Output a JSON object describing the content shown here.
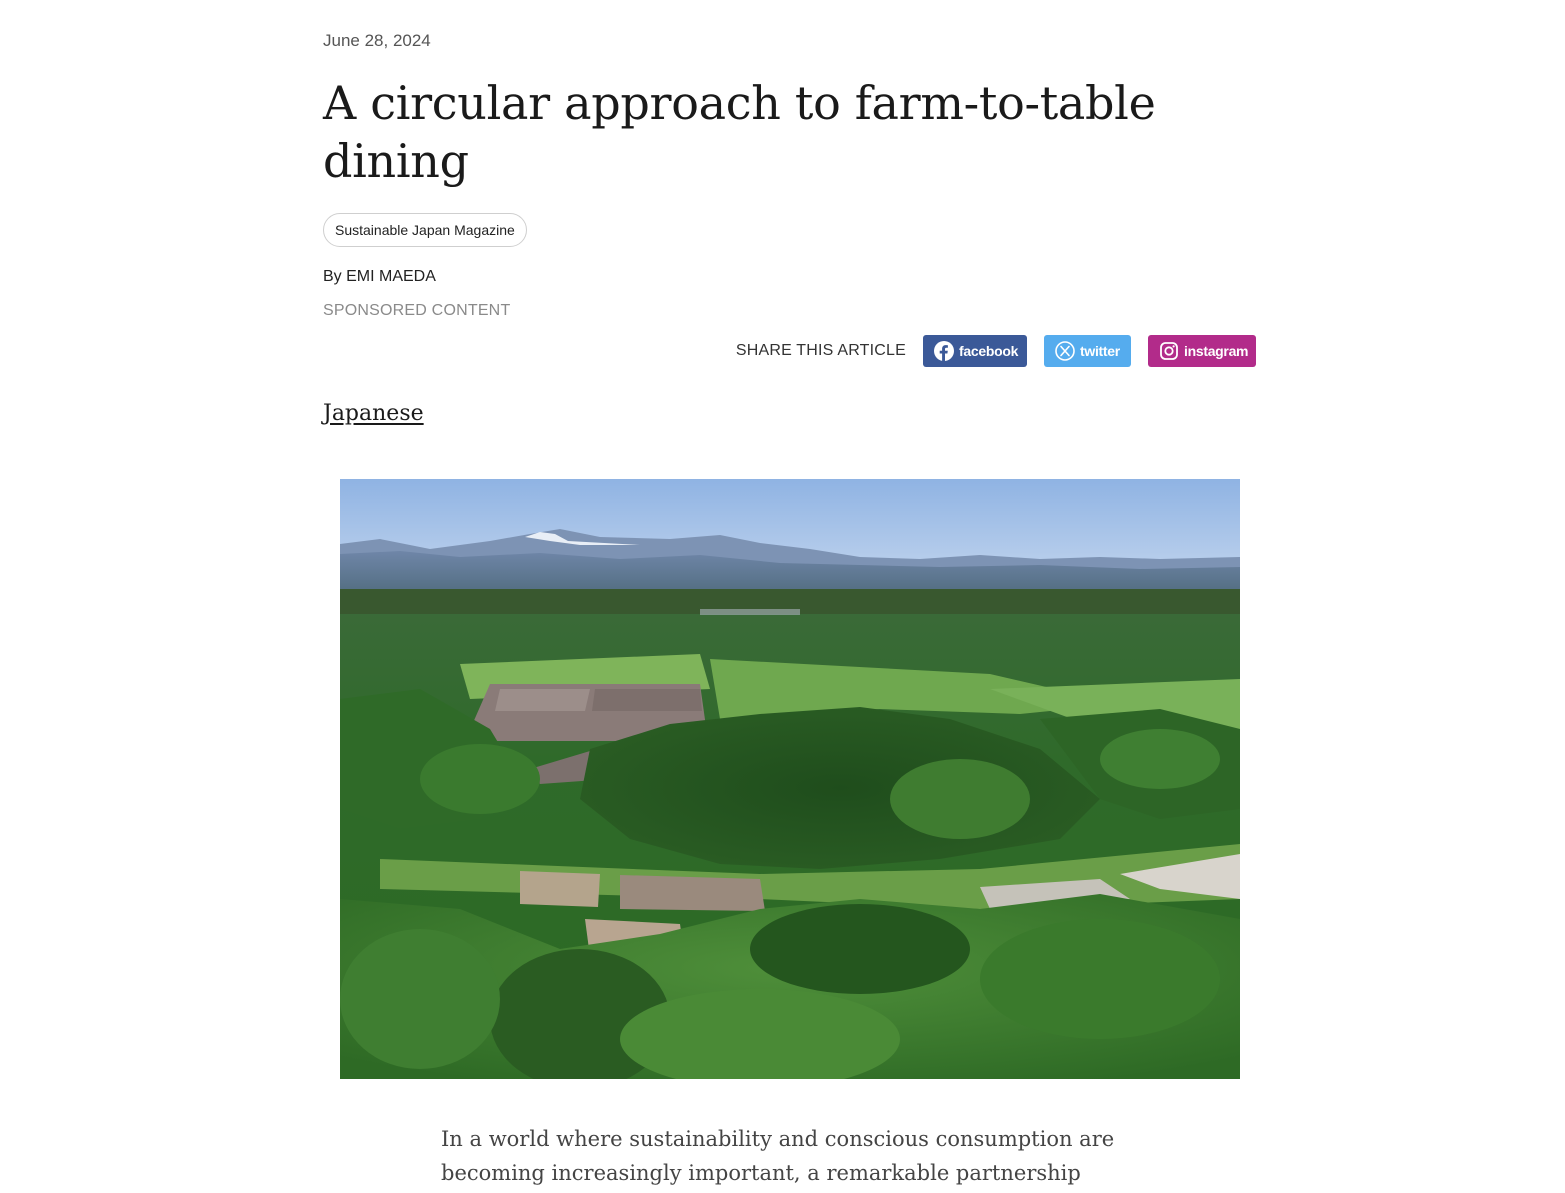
{
  "article": {
    "date": "June 28, 2024",
    "title": "A circular approach to farm-to-table dining",
    "tag": "Sustainable Japan Magazine",
    "byline": "By EMI MAEDA",
    "sponsored": "SPONSORED CONTENT",
    "language_link": "Japanese",
    "body_intro": "In a world where sustainability and conscious consumption are becoming increasingly important, a remarkable partnership"
  },
  "share": {
    "label": "SHARE THIS ARTICLE",
    "buttons": [
      {
        "label": "facebook",
        "icon": "facebook-icon",
        "color": "#3b5998"
      },
      {
        "label": "twitter",
        "icon": "x-twitter-icon",
        "color": "#55acee"
      },
      {
        "label": "instagram",
        "icon": "instagram-icon",
        "color": "#b22b8a"
      }
    ]
  },
  "hero_image": {
    "description_icon": "aerial-farmland-photo"
  }
}
